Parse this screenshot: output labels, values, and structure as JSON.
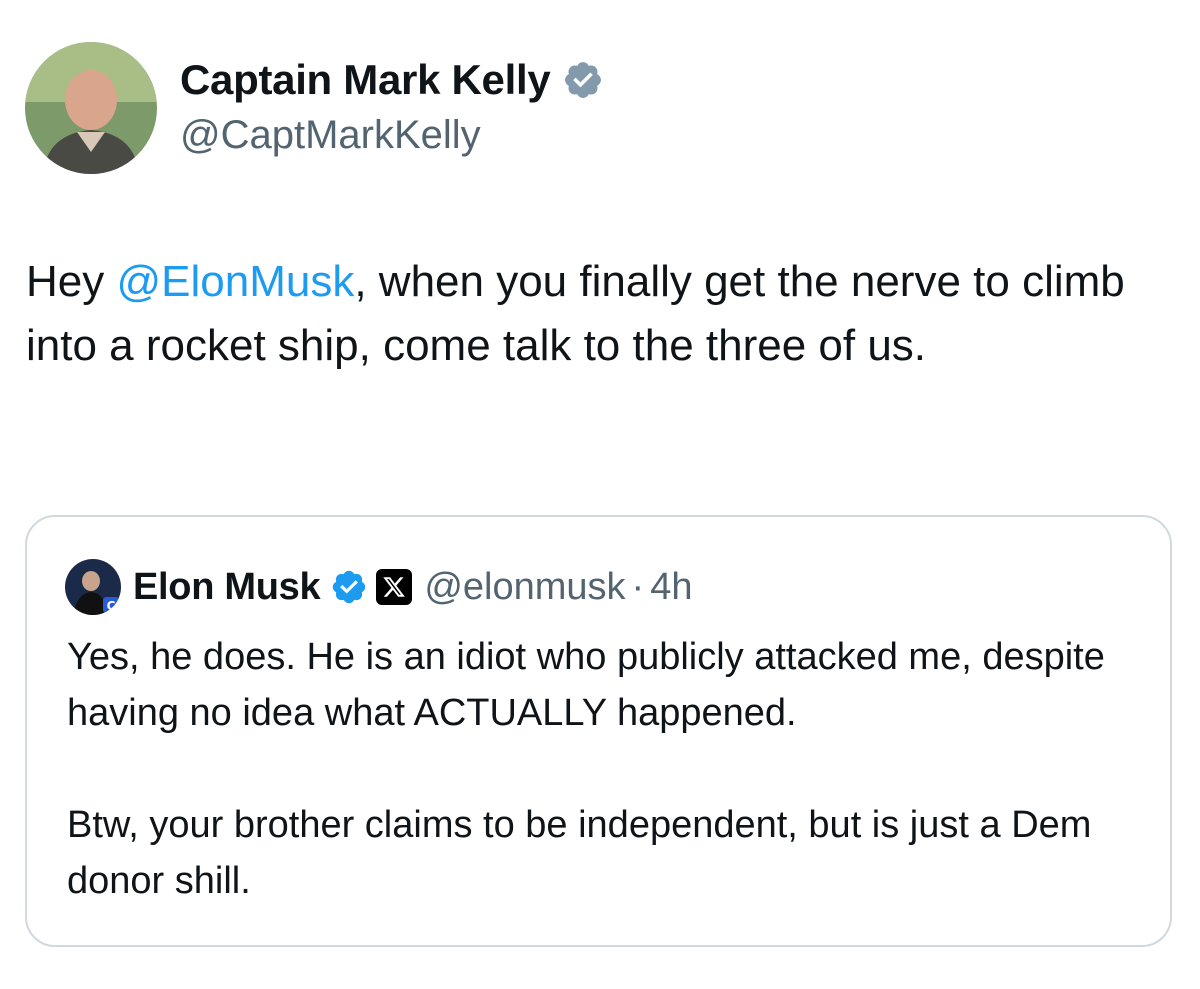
{
  "tweet": {
    "author_name": "Captain Mark Kelly",
    "author_handle": "@CaptMarkKelly",
    "verified": true,
    "text_before": "Hey ",
    "mention": "@ElonMusk",
    "text_after": ", when you finally get the nerve to climb into a rocket ship, come talk to the three of us."
  },
  "quote": {
    "author_name": "Elon Musk",
    "verified": true,
    "affiliate_badge": "x-logo-badge",
    "author_handle": "@elonmusk",
    "separator": "·",
    "time": "4h",
    "paragraph1": "Yes, he does. He is an idiot who publicly attacked me, despite having no idea what ACTUALLY happened.",
    "paragraph2": "Btw, your brother claims to be independent, but is just a Dem donor shill."
  },
  "colors": {
    "mention": "#1d9bf0",
    "verified_blue": "#1d9bf0",
    "verified_gray": "#829aab",
    "handle_gray": "#536471",
    "border": "#cfd9de"
  }
}
